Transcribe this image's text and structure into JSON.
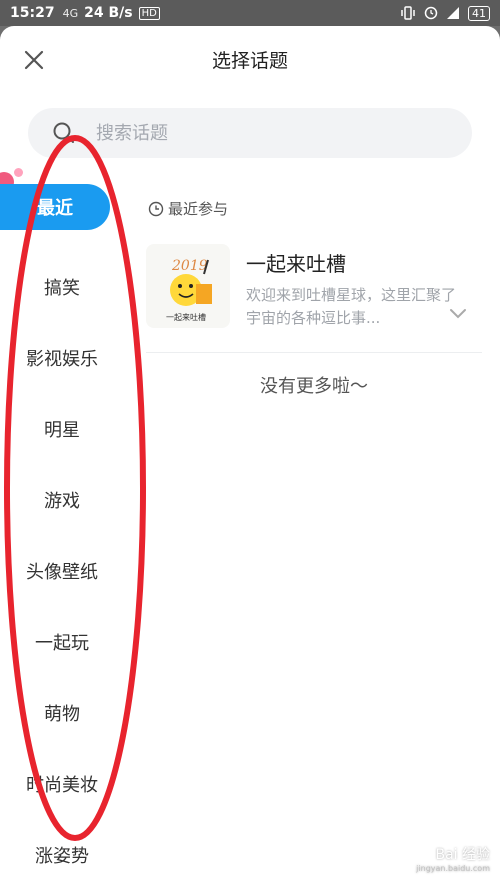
{
  "status_bar": {
    "time": "15:27",
    "network": "4G",
    "speed": "24 B/s",
    "hd": "HD",
    "battery": "41"
  },
  "header": {
    "title": "选择话题",
    "close_icon": "close-icon"
  },
  "search": {
    "placeholder": "搜索话题",
    "icon": "search-icon"
  },
  "sidebar": {
    "items": [
      {
        "label": "最近",
        "active": true
      },
      {
        "label": "搞笑"
      },
      {
        "label": "影视娱乐"
      },
      {
        "label": "明星"
      },
      {
        "label": "游戏"
      },
      {
        "label": "头像壁纸"
      },
      {
        "label": "一起玩"
      },
      {
        "label": "萌物"
      },
      {
        "label": "时尚美妆"
      },
      {
        "label": "涨姿势"
      }
    ]
  },
  "main": {
    "section_label": "最近参与",
    "topics": [
      {
        "name": "一起来吐槽",
        "description": "欢迎来到吐槽星球，这里汇聚了宇宙的各种逗比事...",
        "thumb_text": "2019",
        "thumb_caption": "一起来吐槽"
      }
    ],
    "end_text": "没有更多啦～"
  },
  "colors": {
    "accent": "#1a9bf0",
    "annotation": "#e8242e"
  },
  "watermark": {
    "text": "Bai 经验",
    "sub": "jingyan.baidu.com"
  }
}
